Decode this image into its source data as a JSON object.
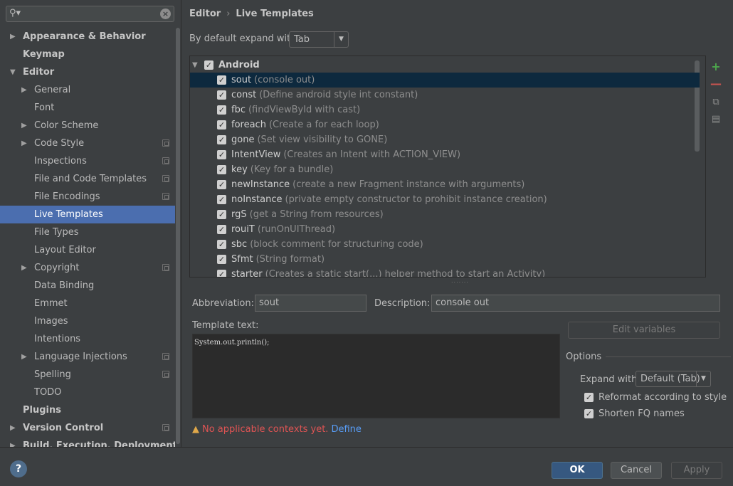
{
  "search": {
    "value": "",
    "icon": "search-icon"
  },
  "sidebar": {
    "items": [
      {
        "label": "Appearance & Behavior",
        "level": 0,
        "arrow": "right",
        "bold": true
      },
      {
        "label": "Keymap",
        "level": 0,
        "arrow": "",
        "bold": true
      },
      {
        "label": "Editor",
        "level": 0,
        "arrow": "down",
        "bold": true
      },
      {
        "label": "General",
        "level": 1,
        "arrow": "right"
      },
      {
        "label": "Font",
        "level": 1,
        "arrow": ""
      },
      {
        "label": "Color Scheme",
        "level": 1,
        "arrow": "right"
      },
      {
        "label": "Code Style",
        "level": 1,
        "arrow": "right",
        "project": true
      },
      {
        "label": "Inspections",
        "level": 1,
        "arrow": "",
        "project": true
      },
      {
        "label": "File and Code Templates",
        "level": 1,
        "arrow": "",
        "project": true
      },
      {
        "label": "File Encodings",
        "level": 1,
        "arrow": "",
        "project": true
      },
      {
        "label": "Live Templates",
        "level": 1,
        "arrow": "",
        "selected": true
      },
      {
        "label": "File Types",
        "level": 1,
        "arrow": ""
      },
      {
        "label": "Layout Editor",
        "level": 1,
        "arrow": ""
      },
      {
        "label": "Copyright",
        "level": 1,
        "arrow": "right",
        "project": true
      },
      {
        "label": "Data Binding",
        "level": 1,
        "arrow": ""
      },
      {
        "label": "Emmet",
        "level": 1,
        "arrow": ""
      },
      {
        "label": "Images",
        "level": 1,
        "arrow": ""
      },
      {
        "label": "Intentions",
        "level": 1,
        "arrow": ""
      },
      {
        "label": "Language Injections",
        "level": 1,
        "arrow": "right",
        "project": true
      },
      {
        "label": "Spelling",
        "level": 1,
        "arrow": "",
        "project": true
      },
      {
        "label": "TODO",
        "level": 1,
        "arrow": ""
      },
      {
        "label": "Plugins",
        "level": 0,
        "arrow": "",
        "bold": true
      },
      {
        "label": "Version Control",
        "level": 0,
        "arrow": "right",
        "bold": true,
        "project": true
      },
      {
        "label": "Build, Execution, Deployment",
        "level": 0,
        "arrow": "right",
        "bold": true
      }
    ]
  },
  "breadcrumb": {
    "parent": "Editor",
    "separator": "›",
    "current": "Live Templates"
  },
  "expand": {
    "label": "By default expand with",
    "value": "Tab"
  },
  "templates": {
    "group": "Android",
    "rows": [
      {
        "abbr": "sout",
        "desc": "(console out)",
        "selected": true
      },
      {
        "abbr": "const",
        "desc": "(Define android style int constant)"
      },
      {
        "abbr": "fbc",
        "desc": "(findViewById with cast)"
      },
      {
        "abbr": "foreach",
        "desc": "(Create a for each loop)"
      },
      {
        "abbr": "gone",
        "desc": "(Set view visibility to GONE)"
      },
      {
        "abbr": "IntentView",
        "desc": "(Creates an Intent with ACTION_VIEW)"
      },
      {
        "abbr": "key",
        "desc": "(Key for a bundle)"
      },
      {
        "abbr": "newInstance",
        "desc": "(create a new Fragment instance with arguments)"
      },
      {
        "abbr": "noInstance",
        "desc": "(private empty constructor to prohibit instance creation)"
      },
      {
        "abbr": "rgS",
        "desc": "(get a String from resources)"
      },
      {
        "abbr": "rouiT",
        "desc": "(runOnUIThread)"
      },
      {
        "abbr": "sbc",
        "desc": "(block comment for structuring code)"
      },
      {
        "abbr": "Sfmt",
        "desc": "(String format)"
      },
      {
        "abbr": "starter",
        "desc": "(Creates a static start(...) helper method to start an Activity)"
      }
    ]
  },
  "tools": {
    "add": "+",
    "remove": "—",
    "copy": "⧉",
    "edit": "▤"
  },
  "details": {
    "abbreviation_label": "Abbreviation:",
    "abbreviation_value": "sout",
    "description_label": "Description:",
    "description_value": "console out",
    "template_text_label": "Template text:",
    "template_text": "System.out.println();",
    "edit_variables": "Edit variables"
  },
  "options": {
    "title": "Options",
    "expand_label": "Expand with",
    "expand_value": "Default (Tab)",
    "reformat_label": "Reformat according to style",
    "shorten_label": "Shorten FQ names"
  },
  "warning": {
    "text": "No applicable contexts yet.",
    "link": "Define"
  },
  "footer": {
    "help": "?",
    "ok": "OK",
    "cancel": "Cancel",
    "apply": "Apply"
  },
  "colors": {
    "selection": "#4b6eaf",
    "list_selection": "#0d293e",
    "ok_button": "#365880",
    "warning": "#e05454",
    "link": "#589df6"
  }
}
